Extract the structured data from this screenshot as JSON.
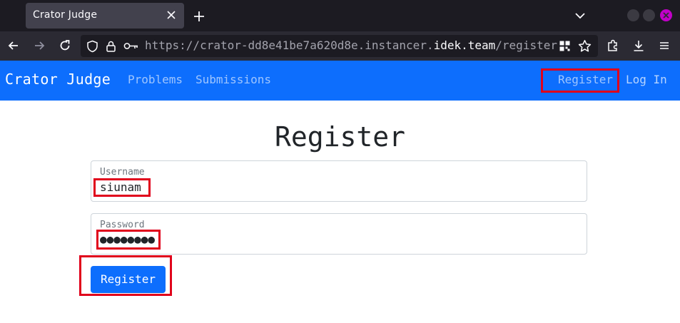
{
  "browser": {
    "tab_title": "Crator Judge",
    "url_scheme": "https://",
    "url_subdomain": "crator-dd8e41be7a620d8e.instancer.",
    "url_host": "idek.team",
    "url_path": "/register",
    "icons": [
      "close-icon",
      "plus-icon",
      "chevron-down-icon",
      "back-icon",
      "forward-icon",
      "reload-icon",
      "shield-icon",
      "lock-icon",
      "key-icon",
      "qr-code-icon",
      "star-icon",
      "extensions-icon",
      "download-icon",
      "menu-icon"
    ]
  },
  "site_nav": {
    "brand": "Crator Judge",
    "links": {
      "problems": "Problems",
      "submissions": "Submissions",
      "register": "Register",
      "login": "Log In"
    }
  },
  "form": {
    "title": "Register",
    "username_label": "Username",
    "username_value": "siunam",
    "password_label": "Password",
    "password_value": "●●●●●●●●",
    "submit_label": "Register"
  },
  "colors": {
    "accent": "#0d6efd",
    "highlight": "#e0001b",
    "browser_dark": "#1c1b22"
  }
}
